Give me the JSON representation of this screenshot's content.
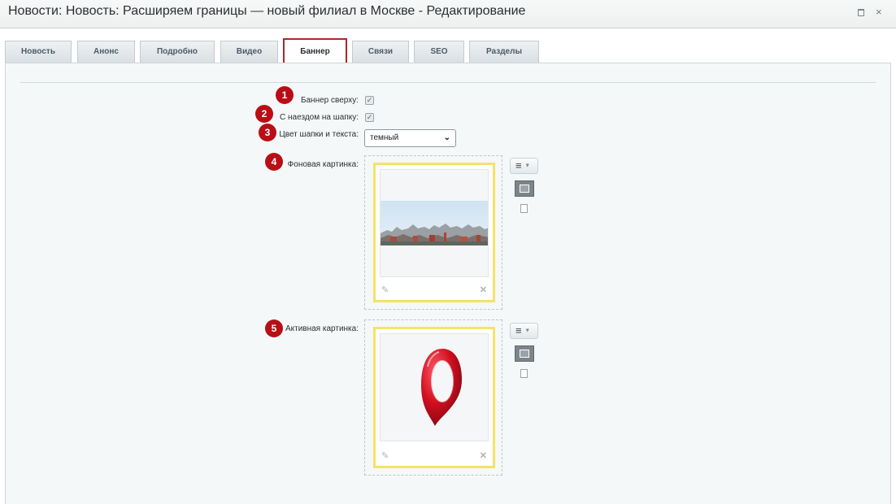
{
  "window": {
    "title": "Новости: Новость: Расширяем границы — новый филиал в Москве - Редактирование",
    "maximize_icon": "maximize-icon",
    "close_icon": "close-icon",
    "close_glyph": "×"
  },
  "tabs": [
    {
      "label": "Новость",
      "active": false
    },
    {
      "label": "Анонс",
      "active": false
    },
    {
      "label": "Подробно",
      "active": false
    },
    {
      "label": "Видео",
      "active": false
    },
    {
      "label": "Баннер",
      "active": true
    },
    {
      "label": "Связи",
      "active": false
    },
    {
      "label": "SEO",
      "active": false
    },
    {
      "label": "Разделы",
      "active": false
    }
  ],
  "form": {
    "banner_top": {
      "label": "Баннер сверху:",
      "marker": "1",
      "checked": true
    },
    "header_overlap": {
      "label": "С наездом на шапку:",
      "marker": "2",
      "checked": true
    },
    "header_color": {
      "label": "Цвет шапки и текста:",
      "marker": "3",
      "value": "темный"
    },
    "background_image": {
      "label": "Фоновая картинка:",
      "marker": "4",
      "image": "moscow-panorama"
    },
    "active_image": {
      "label": "Активная картинка:",
      "marker": "5",
      "image": "red-map-pin"
    }
  },
  "colors": {
    "accent": "#b0262b",
    "marker": "#b80f16",
    "card_border": "#f5e26b"
  }
}
